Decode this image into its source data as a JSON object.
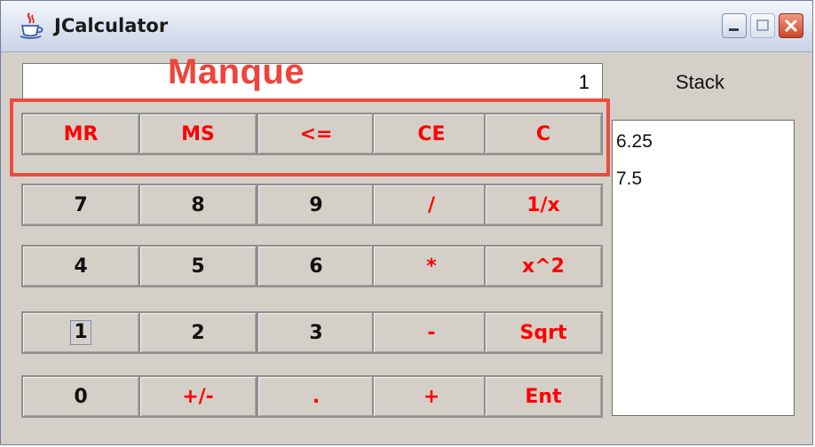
{
  "window": {
    "title": "JCalculator",
    "icon": "java-coffee-cup-icon"
  },
  "title_buttons": {
    "minimize": "minimize-icon",
    "maximize": "maximize-icon",
    "close": "close-icon"
  },
  "display": {
    "value": "1"
  },
  "annotation": {
    "label": "Manque",
    "color": "#f04a40"
  },
  "buttons": {
    "row1": [
      "MR",
      "MS",
      "<=",
      "CE",
      "C"
    ],
    "row2": [
      "7",
      "8",
      "9",
      "/",
      "1/x"
    ],
    "row3": [
      "4",
      "5",
      "6",
      "*",
      "x^2"
    ],
    "row4": [
      "1",
      "2",
      "3",
      "-",
      "Sqrt"
    ],
    "row5": [
      "0",
      "+/-",
      ".",
      "+",
      "Ent"
    ]
  },
  "stack": {
    "label": "Stack",
    "items": [
      "6.25",
      "7.5"
    ]
  },
  "colors": {
    "operator_text": "#ff0000",
    "digit_text": "#111111",
    "window_bg": "#d4d0c8"
  }
}
